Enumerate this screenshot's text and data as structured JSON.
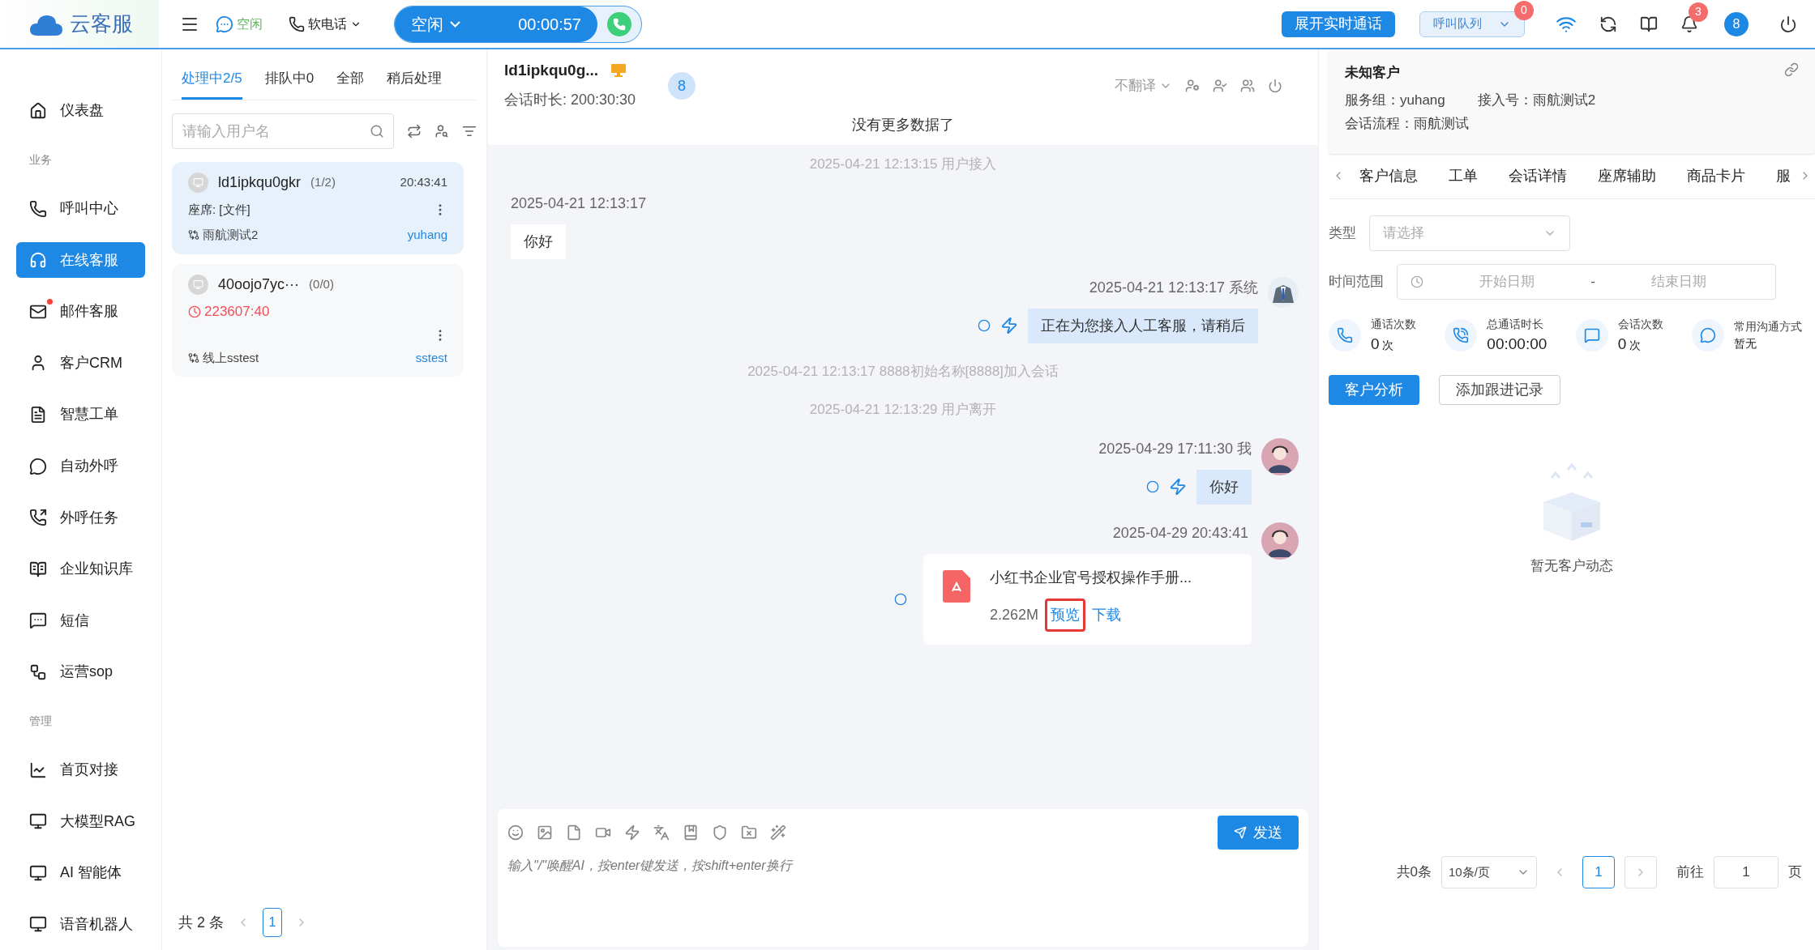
{
  "brand": {
    "name": "云客服"
  },
  "topbar": {
    "agent_status": "空闲",
    "phone_menu": "软电话",
    "call_state": "空闲",
    "call_timer": "00:00:57",
    "expand_button": "展开实时通话",
    "queue": {
      "label": "呼叫队列",
      "badge": "0"
    },
    "notifications": "3",
    "avatar": "8"
  },
  "sidebar": {
    "items": [
      {
        "kind": "item",
        "label": "仪表盘",
        "selected": false,
        "dot": false
      },
      {
        "kind": "section",
        "label": "业务"
      },
      {
        "kind": "item",
        "label": "呼叫中心",
        "selected": false,
        "dot": false
      },
      {
        "kind": "item",
        "label": "在线客服",
        "selected": true,
        "dot": false
      },
      {
        "kind": "item",
        "label": "邮件客服",
        "selected": false,
        "dot": true
      },
      {
        "kind": "item",
        "label": "客户CRM",
        "selected": false,
        "dot": false
      },
      {
        "kind": "item",
        "label": "智慧工单",
        "selected": false,
        "dot": false
      },
      {
        "kind": "item",
        "label": "自动外呼",
        "selected": false,
        "dot": false
      },
      {
        "kind": "item",
        "label": "外呼任务",
        "selected": false,
        "dot": false
      },
      {
        "kind": "item",
        "label": "企业知识库",
        "selected": false,
        "dot": false
      },
      {
        "kind": "item",
        "label": "短信",
        "selected": false,
        "dot": false
      },
      {
        "kind": "item",
        "label": "运营sop",
        "selected": false,
        "dot": false
      },
      {
        "kind": "section",
        "label": "管理"
      },
      {
        "kind": "item",
        "label": "首页对接",
        "selected": false,
        "dot": false
      },
      {
        "kind": "item",
        "label": "大模型RAG",
        "selected": false,
        "dot": false
      },
      {
        "kind": "item",
        "label": "AI 智能体",
        "selected": false,
        "dot": false
      },
      {
        "kind": "item",
        "label": "语音机器人",
        "selected": false,
        "dot": false
      }
    ]
  },
  "sessions": {
    "tabs": [
      {
        "label": "处理中2/5",
        "selected": true
      },
      {
        "label": "排队中0",
        "selected": false
      },
      {
        "label": "全部",
        "selected": false
      },
      {
        "label": "稍后处理",
        "selected": false
      }
    ],
    "search": {
      "placeholder": "请输入用户名"
    },
    "items": [
      {
        "name": "ld1ipkqu0gkr",
        "count": "(1/2)",
        "time": "20:43:41",
        "kind": "preview",
        "line": "座席: [文件]",
        "route": "雨航测试2",
        "agent": "yuhang",
        "selected": true
      },
      {
        "name": "40oojo7yc···",
        "count": "(0/0)",
        "kind": "timer",
        "line": "223607:40",
        "route": "线上sstest",
        "agent": "sstest",
        "selected": false
      }
    ],
    "pagination": {
      "total": "共 2 条",
      "page": "1"
    }
  },
  "chat": {
    "title": "ld1ipkqu0g...",
    "duration": "会话时长: 200:30:30",
    "badge": "8",
    "translate": "不翻译",
    "messages": [
      {
        "kind": "notice",
        "text": "没有更多数据了"
      },
      {
        "kind": "event",
        "text": "2025-04-21 12:13:15 用户接入"
      },
      {
        "kind": "incoming",
        "meta": "2025-04-21 12:13:17",
        "text": "你好"
      },
      {
        "kind": "system",
        "meta": "2025-04-21 12:13:17 系统",
        "text": "正在为您接入人工客服，请稍后"
      },
      {
        "kind": "event",
        "text": "2025-04-21 12:13:17 8888初始名称[8888]加入会话"
      },
      {
        "kind": "event",
        "text": "2025-04-21 12:13:29 用户离开"
      },
      {
        "kind": "outgoing",
        "meta": "2025-04-29 17:11:30 我",
        "text": "你好"
      },
      {
        "kind": "file",
        "meta": "2025-04-29 20:43:41",
        "text": "小红书企业官号授权操作手册...",
        "size": "2.262M",
        "preview": "预览",
        "download": "下载",
        "highlighted": true
      }
    ],
    "input": {
      "placeholder": "输入\"/\"唤醒AI，按enter键发送，按shift+enter换行",
      "send": "发送"
    }
  },
  "customer": {
    "title": "未知客户",
    "fields": [
      {
        "label": "服务组：",
        "value": "yuhang"
      },
      {
        "label": "接入号：",
        "value": "雨航测试2"
      },
      {
        "label": "会话流程：",
        "value": "雨航测试"
      }
    ],
    "tabs": [
      "客户信息",
      "工单",
      "会话详情",
      "座席辅助",
      "商品卡片",
      "服"
    ],
    "type_filter": {
      "label": "类型",
      "placeholder": "请选择"
    },
    "time_filter": {
      "label": "时间范围",
      "start": "开始日期",
      "separator": "-",
      "end": "结束日期"
    },
    "stats": [
      {
        "label": "通话次数",
        "value": "0",
        "unit": "次"
      },
      {
        "label": "总通话时长",
        "value": "00:00:00"
      },
      {
        "label": "会话次数",
        "value": "0",
        "unit": "次"
      },
      {
        "label": "常用沟通方式",
        "value": "暂无"
      }
    ],
    "buttons": [
      {
        "label": "客户分析",
        "primary": true
      },
      {
        "label": "添加跟进记录",
        "primary": false
      }
    ],
    "empty": "暂无客户动态",
    "pagination": {
      "total": "共0条",
      "size": "10条/页",
      "page": "1",
      "goto": "前往",
      "goto_value": "1",
      "unit": "页"
    }
  }
}
